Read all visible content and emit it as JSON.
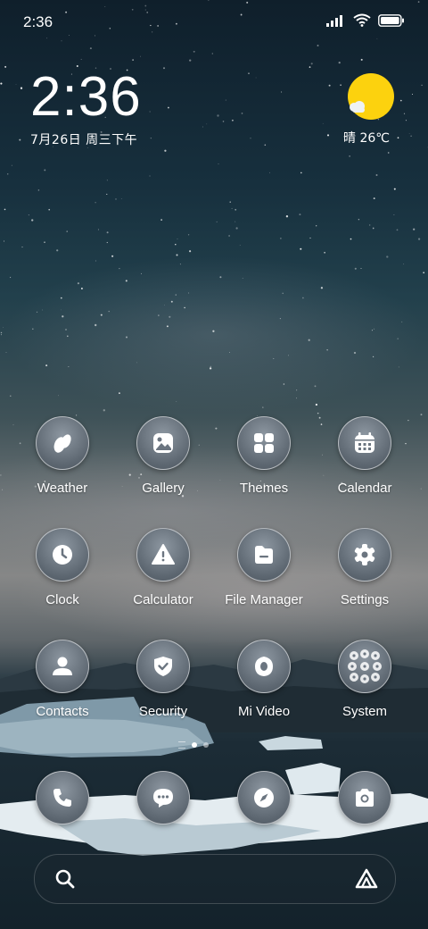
{
  "status_bar": {
    "time": "2:36",
    "icons": [
      "signal-icon",
      "wifi-icon",
      "battery-icon"
    ]
  },
  "clock_widget": {
    "time": "2:36",
    "date": "7月26日 周三下午"
  },
  "weather_widget": {
    "icon": "sun-cloud-icon",
    "text": "晴 26℃"
  },
  "apps": [
    {
      "label": "Weather",
      "icon": "weather-icon"
    },
    {
      "label": "Gallery",
      "icon": "gallery-icon"
    },
    {
      "label": "Themes",
      "icon": "themes-icon"
    },
    {
      "label": "Calendar",
      "icon": "calendar-icon"
    },
    {
      "label": "Clock",
      "icon": "clock-icon"
    },
    {
      "label": "Calculator",
      "icon": "calculator-icon"
    },
    {
      "label": "File Manager",
      "icon": "file-manager-icon"
    },
    {
      "label": "Settings",
      "icon": "settings-icon"
    },
    {
      "label": "Contacts",
      "icon": "contacts-icon"
    },
    {
      "label": "Security",
      "icon": "security-icon"
    },
    {
      "label": "Mi Video",
      "icon": "mi-video-icon"
    },
    {
      "label": "System",
      "icon": "system-folder-icon"
    }
  ],
  "dock": [
    {
      "icon": "phone-icon"
    },
    {
      "icon": "messages-icon"
    },
    {
      "icon": "browser-icon"
    },
    {
      "icon": "camera-icon"
    }
  ],
  "search_bar": {
    "left_icon": "search-icon",
    "right_icon": "assistant-icon"
  },
  "colors": {
    "sun": "#fcd20e",
    "icon_bg": "#6b7580"
  }
}
